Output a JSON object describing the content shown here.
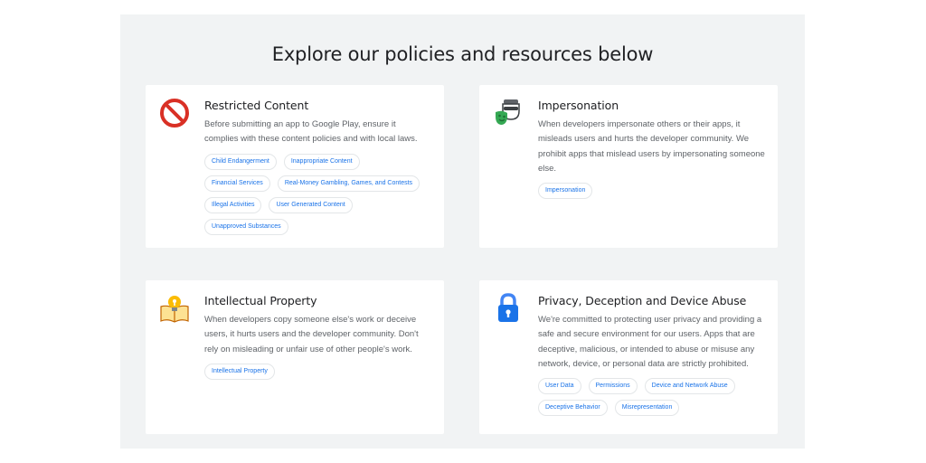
{
  "heading": "Explore our policies and resources below",
  "cards": [
    {
      "icon": "prohibited-icon",
      "title": "Restricted Content",
      "description": "Before submitting an app to Google Play, ensure it complies with these content policies and with local laws.",
      "tags": [
        "Child Endangerment",
        "Inappropriate Content",
        "Financial Services",
        "Real-Money Gambling, Games, and Contests",
        "Illegal Activities",
        "User Generated Content",
        "Unapproved Substances"
      ]
    },
    {
      "icon": "masks-icon",
      "title": "Impersonation",
      "description": "When developers impersonate others or their apps, it misleads users and hurts the developer community. We prohibit apps that mislead users by impersonating someone else.",
      "tags": [
        "Impersonation"
      ]
    },
    {
      "icon": "lightbulb-book-icon",
      "title": "Intellectual Property",
      "description": "When developers copy someone else's work or deceive users, it hurts users and the developer community. Don't rely on misleading or unfair use of other people's work.",
      "tags": [
        "Intellectual Property"
      ]
    },
    {
      "icon": "lock-icon",
      "title": "Privacy, Deception and Device Abuse",
      "description": "We're committed to protecting user privacy and providing a safe and secure environment for our users. Apps that are deceptive, malicious, or intended to abuse or misuse any network, device, or personal data are strictly prohibited.",
      "tags": [
        "User Data",
        "Permissions",
        "Device and Network Abuse",
        "Deceptive Behavior",
        "Misrepresentation"
      ]
    }
  ]
}
